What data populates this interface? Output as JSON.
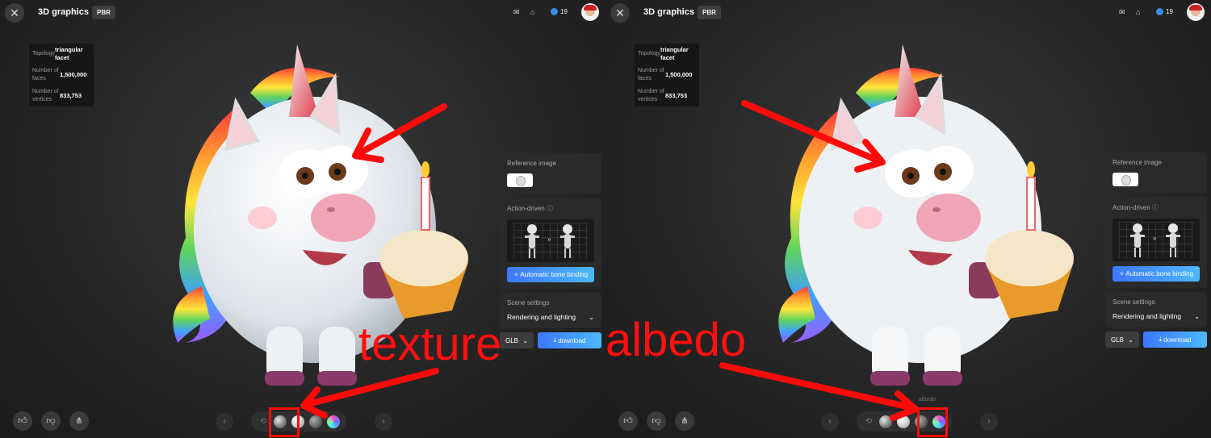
{
  "app": {
    "title": "3D graphics",
    "badge": "PBR",
    "credits": "19"
  },
  "stats": {
    "topology_label": "Topology",
    "topology_value": "triangular facet",
    "faces_label": "Number of faces",
    "faces_value": "1,500,000",
    "vertices_label": "Number of vertices",
    "vertices_value": "833,753"
  },
  "sidebar": {
    "reference_label": "Reference image",
    "action_label": "Action-driven",
    "bone_binding_label": "Automatic bone binding",
    "scene_label": "Scene settings",
    "rendering_label": "Rendering and lighting",
    "format_value": "GLB",
    "download_label": "download"
  },
  "annotations": {
    "left": "texture",
    "right": "albedo",
    "right_tooltip": "albedo"
  },
  "colors": {
    "accent": "#3c78ff",
    "annotation": "#ff0a0a",
    "background": "#262626"
  },
  "icons": [
    "close-icon",
    "mail-icon",
    "gift-icon",
    "coin-icon",
    "thumbs-up-icon",
    "thumbs-down-icon",
    "share-icon",
    "chevron-left-icon",
    "chevron-right-icon",
    "rotate-icon",
    "info-icon",
    "wand-icon",
    "download-icon",
    "chevron-down-icon"
  ]
}
